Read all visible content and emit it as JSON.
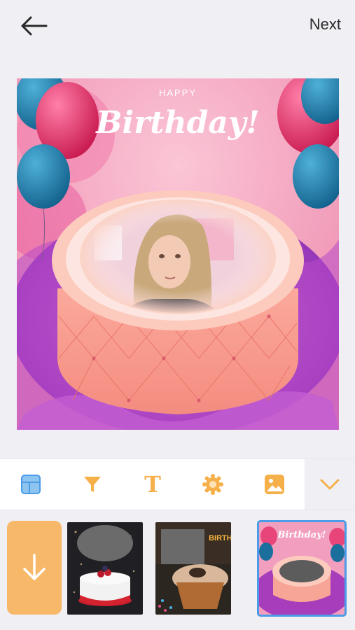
{
  "header": {
    "back_icon": "arrow-left-icon",
    "next_label": "Next"
  },
  "canvas": {
    "frame_kicker": "HAPPY",
    "frame_title": "Birthday!"
  },
  "toolbar": {
    "tools": [
      {
        "icon": "layout-icon",
        "active": true
      },
      {
        "icon": "filter-icon",
        "active": false
      },
      {
        "icon": "text-icon",
        "label": "T",
        "active": false
      },
      {
        "icon": "sticker-icon",
        "active": false
      },
      {
        "icon": "image-icon",
        "active": false
      }
    ],
    "collapse_icon": "chevron-down-icon"
  },
  "tray": {
    "download_icon": "arrow-down-icon",
    "thumbnails": [
      {
        "name": "thumb-red-cake",
        "selected": false
      },
      {
        "name": "thumb-cupcake",
        "caption": "BIRTHDAY",
        "selected": false
      },
      {
        "name": "thumb-pink-cake",
        "caption": "Birthday!",
        "selected": true
      }
    ]
  },
  "colors": {
    "accent": "#f6b04a",
    "active_tool": "#4a9be8",
    "frame_pink": "#f6a9c4",
    "background": "#efeff4"
  }
}
